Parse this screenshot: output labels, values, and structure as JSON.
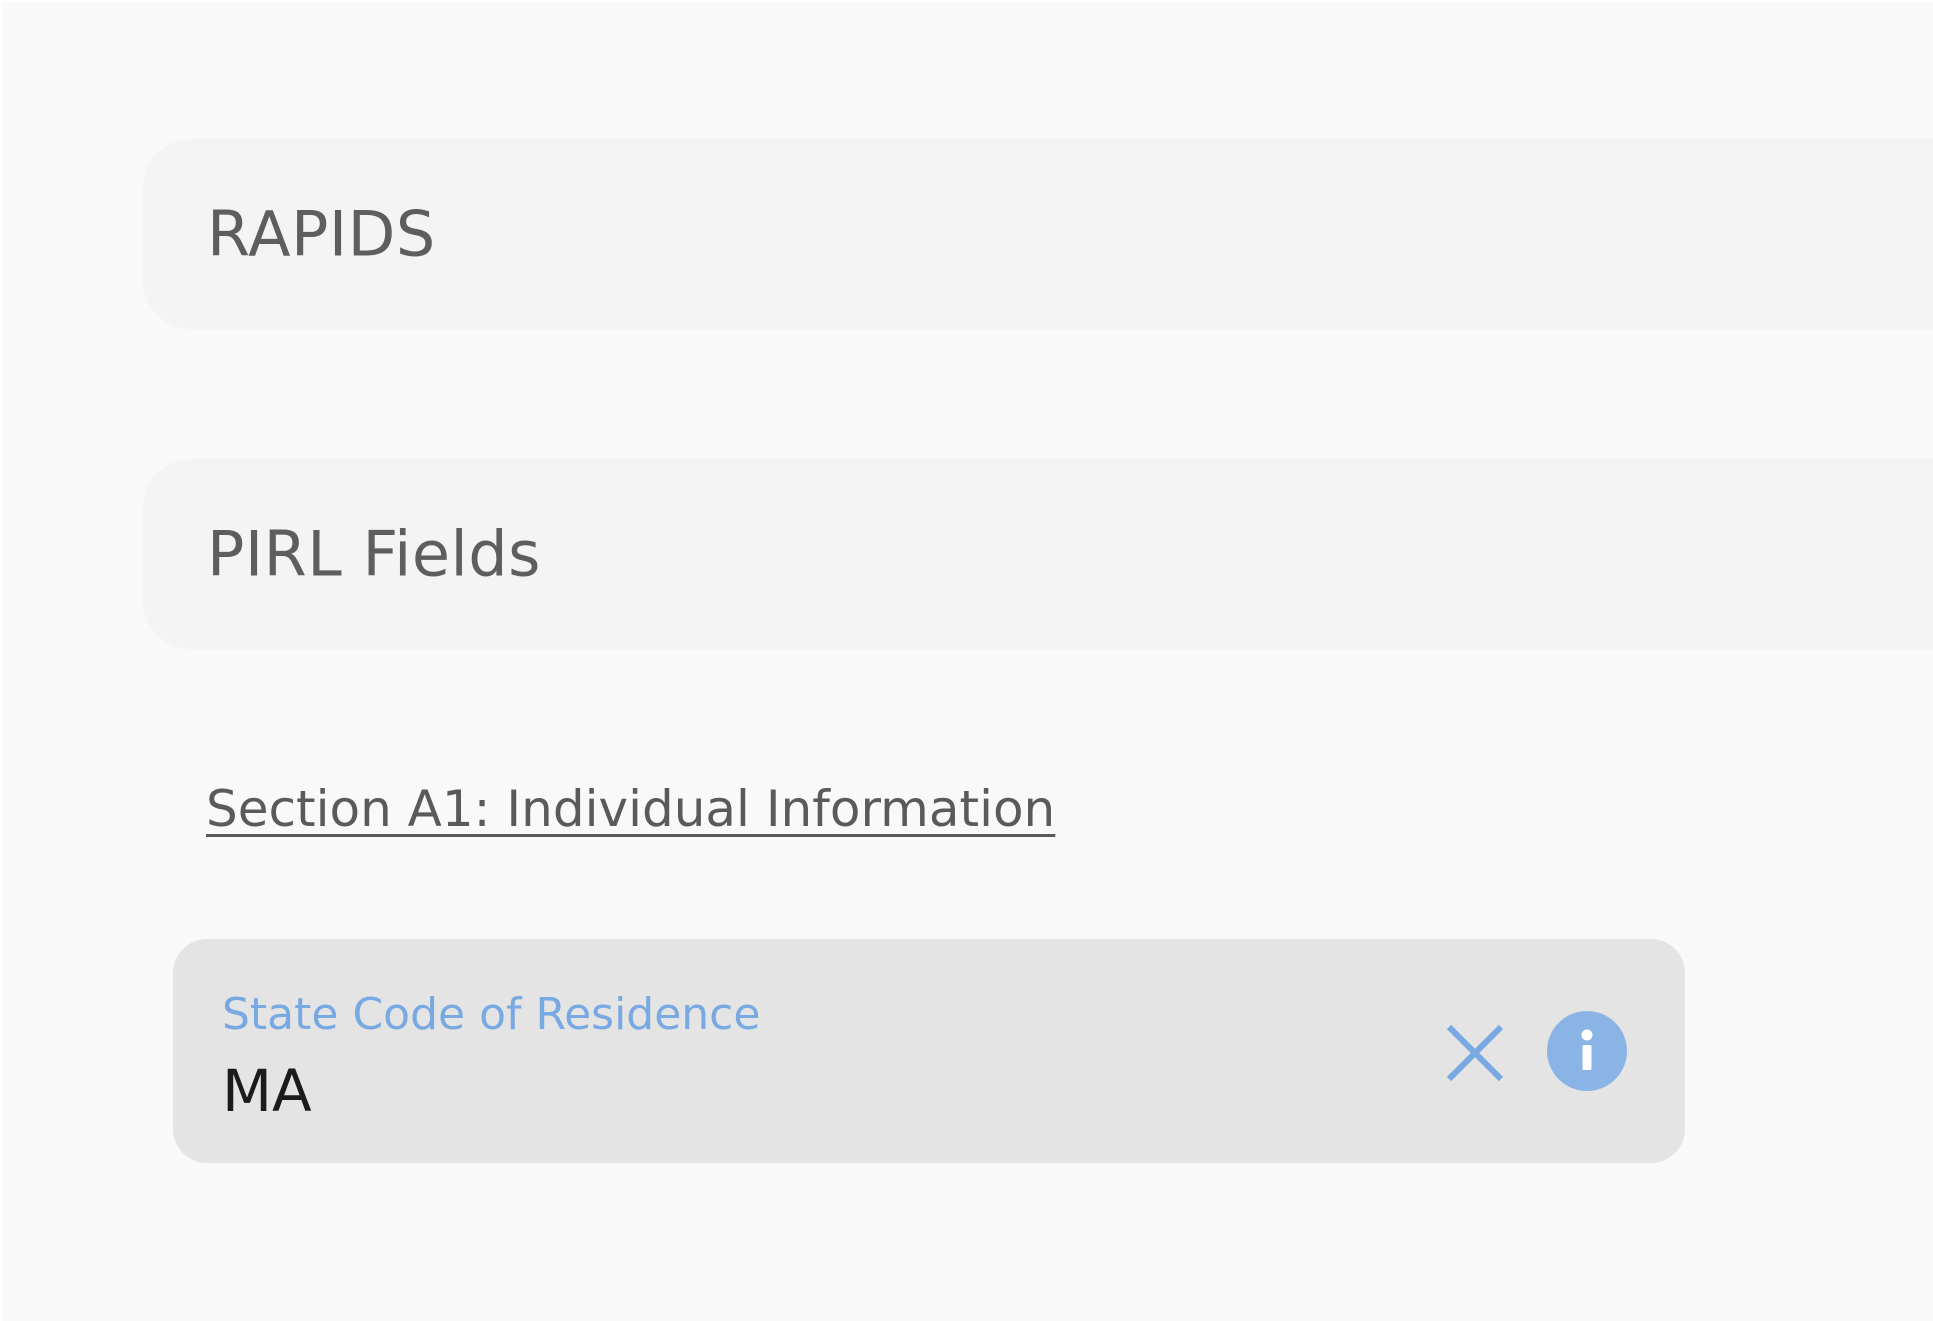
{
  "panels": {
    "rapids": {
      "title": "RAPIDS"
    },
    "pirl": {
      "title": "PIRL Fields"
    }
  },
  "section": {
    "heading": "Section A1: Individual Information"
  },
  "state_field": {
    "label": "State Code of Residence",
    "value": "MA",
    "clear_icon": "close-icon",
    "info_icon": "info-icon"
  },
  "colors": {
    "accent": "#78a9e2",
    "info_icon_bg": "#8ab4e6",
    "field_bg": "#e4e4e4",
    "panel_bg": "#f4f4f4",
    "page_bg": "#f9f9f9"
  }
}
